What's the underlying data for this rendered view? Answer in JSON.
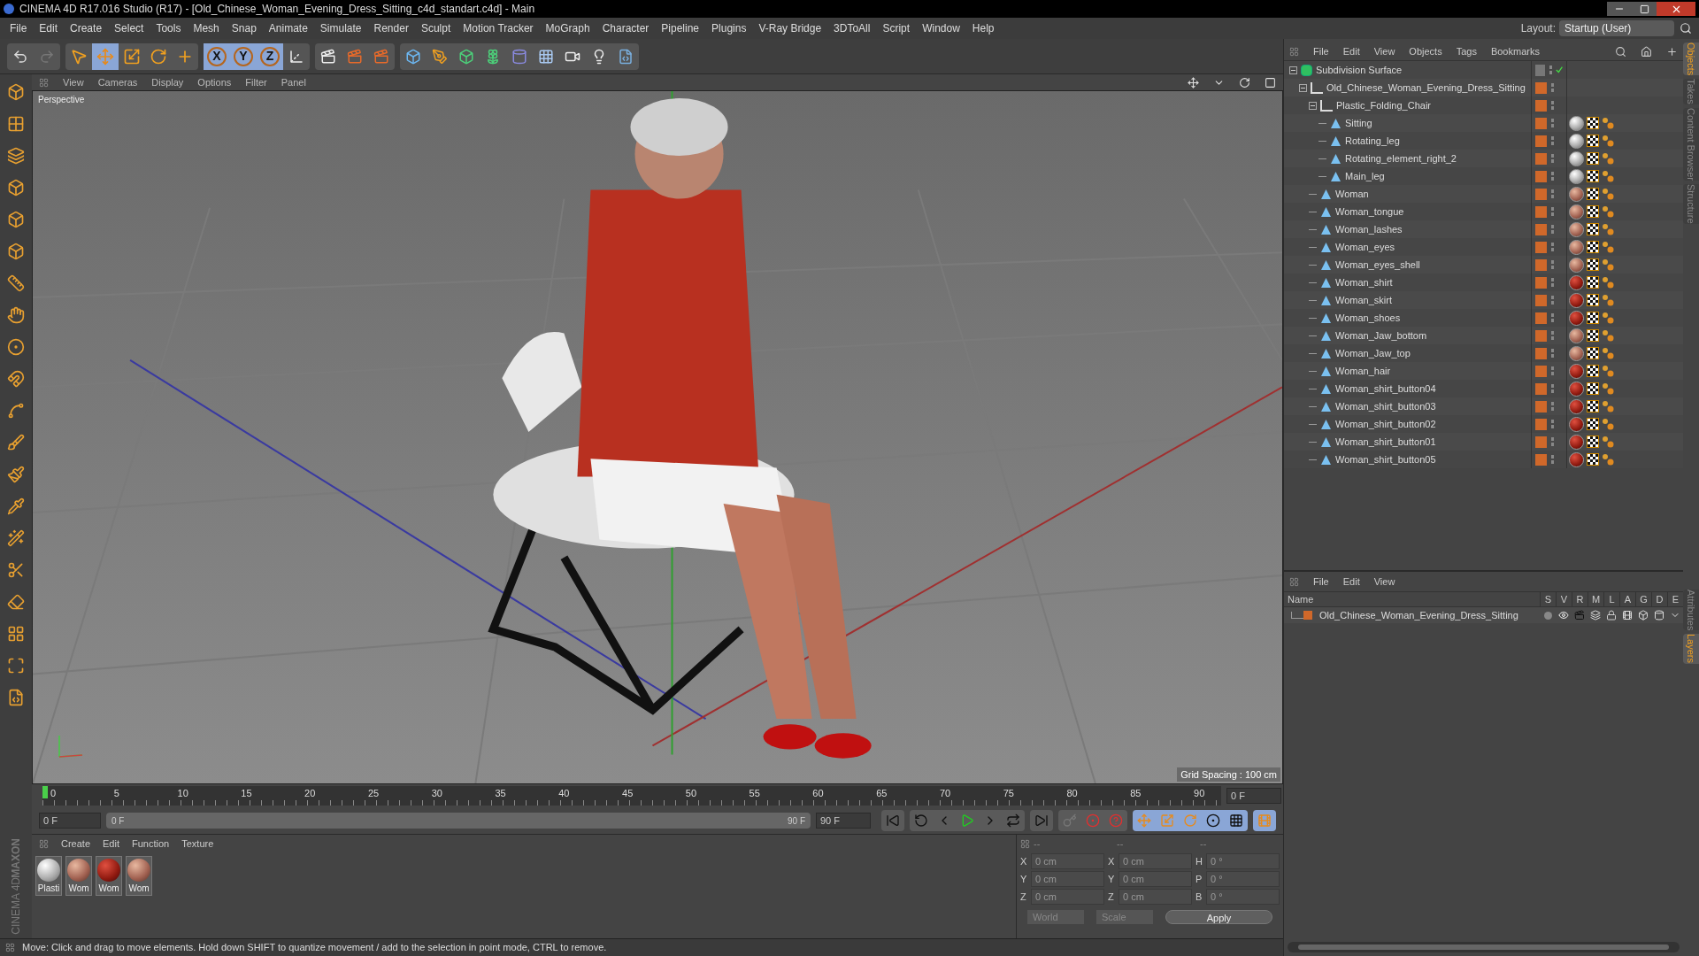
{
  "window": {
    "title": "CINEMA 4D R17.016 Studio (R17) - [Old_Chinese_Woman_Evening_Dress_Sitting_c4d_standart.c4d] - Main"
  },
  "menu_bar": [
    "File",
    "Edit",
    "Create",
    "Select",
    "Tools",
    "Mesh",
    "Snap",
    "Animate",
    "Simulate",
    "Render",
    "Sculpt",
    "Motion Tracker",
    "MoGraph",
    "Character",
    "Pipeline",
    "Plugins",
    "V-Ray Bridge",
    "3DToAll",
    "Script",
    "Window",
    "Help"
  ],
  "layout": {
    "label": "Layout:",
    "value": "Startup (User)"
  },
  "tools": [
    {
      "kind": "selection",
      "selected": false
    },
    {
      "kind": "move",
      "selected": true
    },
    {
      "kind": "scale",
      "selected": false
    },
    {
      "kind": "rotate",
      "selected": false
    },
    {
      "kind": "last",
      "selected": false
    }
  ],
  "axis_locks": [
    {
      "label": "X",
      "on": true
    },
    {
      "label": "Y",
      "on": true
    },
    {
      "label": "Z",
      "on": true
    }
  ],
  "viewport": {
    "menu": [
      "View",
      "Cameras",
      "Display",
      "Options",
      "Filter",
      "Panel"
    ],
    "camera": "Perspective",
    "grid": "Grid Spacing : 100 cm"
  },
  "timeline": {
    "ticks": [
      "0",
      "5",
      "10",
      "15",
      "20",
      "25",
      "30",
      "35",
      "40",
      "45",
      "50",
      "55",
      "60",
      "65",
      "70",
      "75",
      "80",
      "85",
      "90"
    ],
    "current": "0 F",
    "start": "0 F",
    "range": {
      "start": "0 F",
      "end": "90 F",
      "level": 1
    },
    "end": "90 F"
  },
  "materials": {
    "menu": [
      "Create",
      "Edit",
      "Function",
      "Texture"
    ],
    "items": [
      {
        "label": "Plasti",
        "kind": "white"
      },
      {
        "label": "Wom",
        "kind": "skin"
      },
      {
        "label": "Wom",
        "kind": "red"
      },
      {
        "label": "Wom",
        "kind": "skin"
      }
    ]
  },
  "coordinates": {
    "disabled": true,
    "headers": [
      "--",
      "--",
      "--"
    ],
    "rows": [
      {
        "fields": [
          {
            "label": "X",
            "value": "0 cm"
          },
          {
            "label": "X",
            "value": "0 cm"
          },
          {
            "label": "H",
            "value": "0 °"
          }
        ]
      },
      {
        "fields": [
          {
            "label": "Y",
            "value": "0 cm"
          },
          {
            "label": "Y",
            "value": "0 cm"
          },
          {
            "label": "P",
            "value": "0 °"
          }
        ]
      },
      {
        "fields": [
          {
            "label": "Z",
            "value": "0 cm"
          },
          {
            "label": "Z",
            "value": "0 cm"
          },
          {
            "label": "B",
            "value": "0 °"
          }
        ]
      }
    ],
    "dropdowns": [
      "World",
      "Scale"
    ],
    "apply": "Apply"
  },
  "brand": [
    "MAXON",
    "CINEMA 4D"
  ],
  "status_bar": "Move: Click and drag to move elements. Hold down SHIFT to quantize movement / add to the selection in point mode, CTRL to remove.",
  "objects": {
    "menu": [
      "File",
      "Edit",
      "View",
      "Objects",
      "Tags",
      "Bookmarks"
    ],
    "tree": [
      {
        "name": "Subdivision Surface",
        "kind": "subdivision",
        "enabled": true,
        "expanded": true,
        "children": [
          {
            "name": "Old_Chinese_Woman_Evening_Dress_Sitting",
            "kind": "null",
            "expanded": true,
            "children": [
              {
                "name": "Plastic_Folding_Chair",
                "kind": "null",
                "expanded": true,
                "children": [
                  {
                    "name": "Sitting",
                    "kind": "polygon",
                    "material_tag": {
                      "kind": "white"
                    }
                  },
                  {
                    "name": "Rotating_leg",
                    "kind": "polygon",
                    "material_tag": {
                      "kind": "white"
                    }
                  },
                  {
                    "name": "Rotating_element_right_2",
                    "kind": "polygon",
                    "material_tag": {
                      "kind": "white"
                    }
                  },
                  {
                    "name": "Main_leg",
                    "kind": "polygon",
                    "material_tag": {
                      "kind": "white"
                    }
                  }
                ]
              },
              {
                "name": "Woman",
                "kind": "polygon",
                "material_tag": {
                  "kind": "skin"
                }
              },
              {
                "name": "Woman_tongue",
                "kind": "polygon",
                "material_tag": {
                  "kind": "skin"
                }
              },
              {
                "name": "Woman_lashes",
                "kind": "polygon",
                "material_tag": {
                  "kind": "skin"
                }
              },
              {
                "name": "Woman_eyes",
                "kind": "polygon",
                "material_tag": {
                  "kind": "skin"
                }
              },
              {
                "name": "Woman_eyes_shell",
                "kind": "polygon",
                "material_tag": {
                  "kind": "skin"
                }
              },
              {
                "name": "Woman_shirt",
                "kind": "polygon",
                "material_tag": {
                  "kind": "red"
                }
              },
              {
                "name": "Woman_skirt",
                "kind": "polygon",
                "material_tag": {
                  "kind": "red"
                }
              },
              {
                "name": "Woman_shoes",
                "kind": "polygon",
                "material_tag": {
                  "kind": "red"
                }
              },
              {
                "name": "Woman_Jaw_bottom",
                "kind": "polygon",
                "material_tag": {
                  "kind": "skin"
                }
              },
              {
                "name": "Woman_Jaw_top",
                "kind": "polygon",
                "material_tag": {
                  "kind": "skin"
                }
              },
              {
                "name": "Woman_hair",
                "kind": "polygon",
                "material_tag": {
                  "kind": "red"
                }
              },
              {
                "name": "Woman_shirt_button04",
                "kind": "polygon",
                "material_tag": {
                  "kind": "red"
                }
              },
              {
                "name": "Woman_shirt_button03",
                "kind": "polygon",
                "material_tag": {
                  "kind": "red"
                }
              },
              {
                "name": "Woman_shirt_button02",
                "kind": "polygon",
                "material_tag": {
                  "kind": "red"
                }
              },
              {
                "name": "Woman_shirt_button01",
                "kind": "polygon",
                "material_tag": {
                  "kind": "red"
                }
              },
              {
                "name": "Woman_shirt_button05",
                "kind": "polygon",
                "material_tag": {
                  "kind": "red"
                }
              }
            ]
          }
        ]
      }
    ]
  },
  "side_tabs": [
    {
      "label": "Objects",
      "selected": true
    },
    {
      "label": "Takes",
      "selected": false
    },
    {
      "label": "Content Browser",
      "selected": false
    },
    {
      "label": "Structure",
      "selected": false
    }
  ],
  "layers": {
    "menu": [
      "File",
      "Edit",
      "View"
    ],
    "columns": [
      "Name",
      "S",
      "V",
      "R",
      "M",
      "L",
      "A",
      "G",
      "D",
      "E"
    ],
    "rows": [
      {
        "name": "Old_Chinese_Woman_Evening_Dress_Sitting",
        "color": "#d0682a"
      }
    ]
  },
  "lower_tabs": [
    {
      "label": "Attributes",
      "selected": false
    },
    {
      "label": "Layers",
      "selected": true
    }
  ]
}
